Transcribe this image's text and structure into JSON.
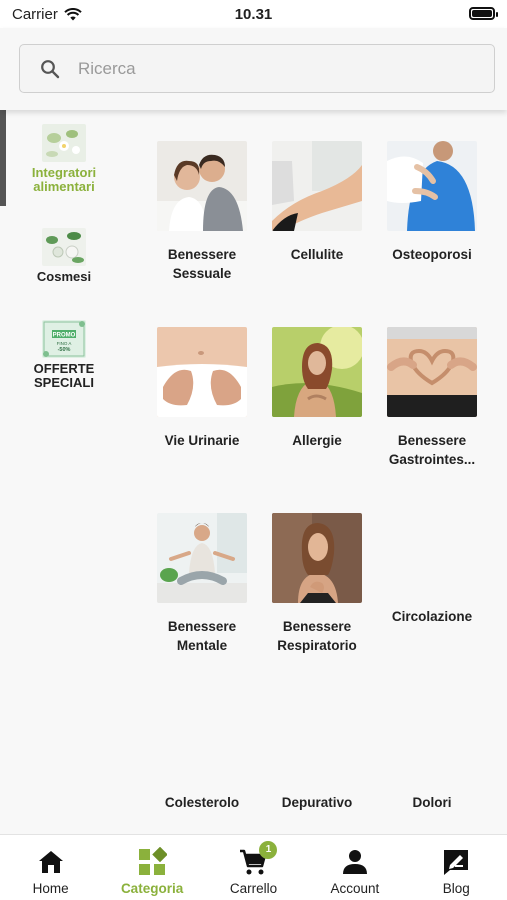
{
  "status_bar": {
    "carrier": "Carrier",
    "time": "10.31"
  },
  "search": {
    "placeholder": "Ricerca",
    "value": ""
  },
  "sidebar": {
    "items": [
      {
        "label": "Integratori alimentari",
        "active": true
      },
      {
        "label": "Cosmesi",
        "active": false
      },
      {
        "label": "OFFERTE SPECIALI",
        "active": false,
        "promo_badge": "PROMO",
        "promo_lines": [
          "FINO A",
          "-50%"
        ]
      }
    ]
  },
  "categories": [
    {
      "label": "Benessere Sessuale"
    },
    {
      "label": "Cellulite"
    },
    {
      "label": "Osteoporosi"
    },
    {
      "label": "Vie Urinarie"
    },
    {
      "label": "Allergie"
    },
    {
      "label": "Benessere Gastrointes..."
    },
    {
      "label": "Benessere Mentale"
    },
    {
      "label": "Benessere Respiratorio"
    },
    {
      "label": "Circolazione"
    },
    {
      "label": "Colesterolo"
    },
    {
      "label": "Depurativo"
    },
    {
      "label": "Dolori"
    }
  ],
  "bottom_nav": {
    "items": [
      {
        "label": "Home",
        "icon": "home-icon",
        "active": false
      },
      {
        "label": "Categoria",
        "icon": "category-icon",
        "active": true
      },
      {
        "label": "Carrello",
        "icon": "cart-icon",
        "active": false,
        "badge": "1"
      },
      {
        "label": "Account",
        "icon": "account-icon",
        "active": false
      },
      {
        "label": "Blog",
        "icon": "blog-icon",
        "active": false
      }
    ]
  },
  "colors": {
    "accent": "#8bb13c",
    "text": "#222222",
    "background": "#f8f8f8"
  }
}
